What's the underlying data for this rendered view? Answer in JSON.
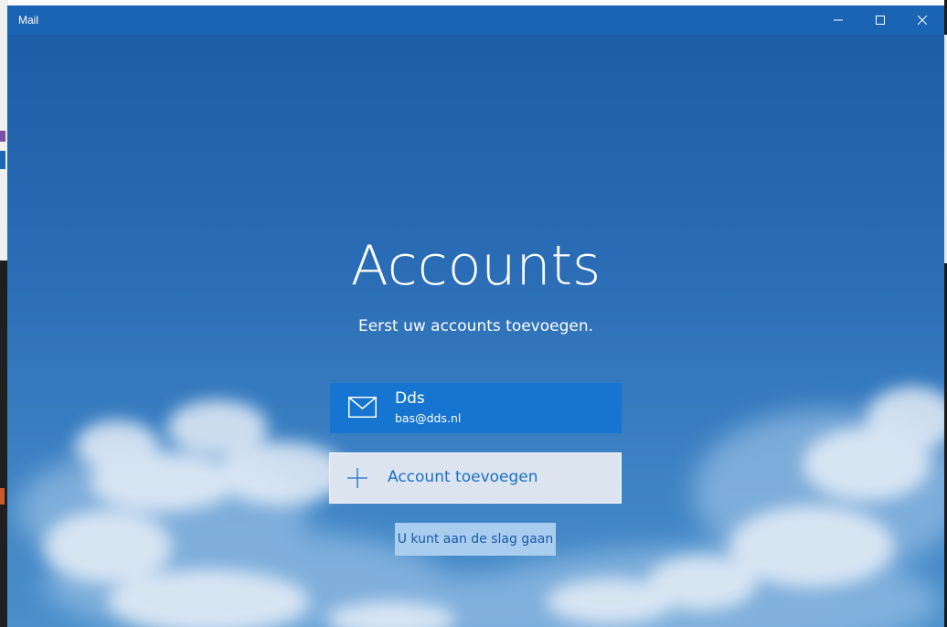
{
  "window": {
    "title": "Mail"
  },
  "main": {
    "heading": "Accounts",
    "subheading": "Eerst uw accounts toevoegen."
  },
  "accounts": [
    {
      "name": "Dds",
      "email": "bas@dds.nl",
      "icon": "mail-icon"
    }
  ],
  "add_account": {
    "label": "Account toevoegen",
    "icon": "plus-icon"
  },
  "start_button": {
    "label": "U kunt aan de slag gaan"
  },
  "colors": {
    "titlebar": "#1b64b3",
    "account_card": "#1575d1",
    "add_account_bg": "#dce5ef",
    "add_account_text": "#1b6fc6",
    "start_button_bg": "#a9cdee",
    "start_button_text": "#1b5aa8"
  }
}
